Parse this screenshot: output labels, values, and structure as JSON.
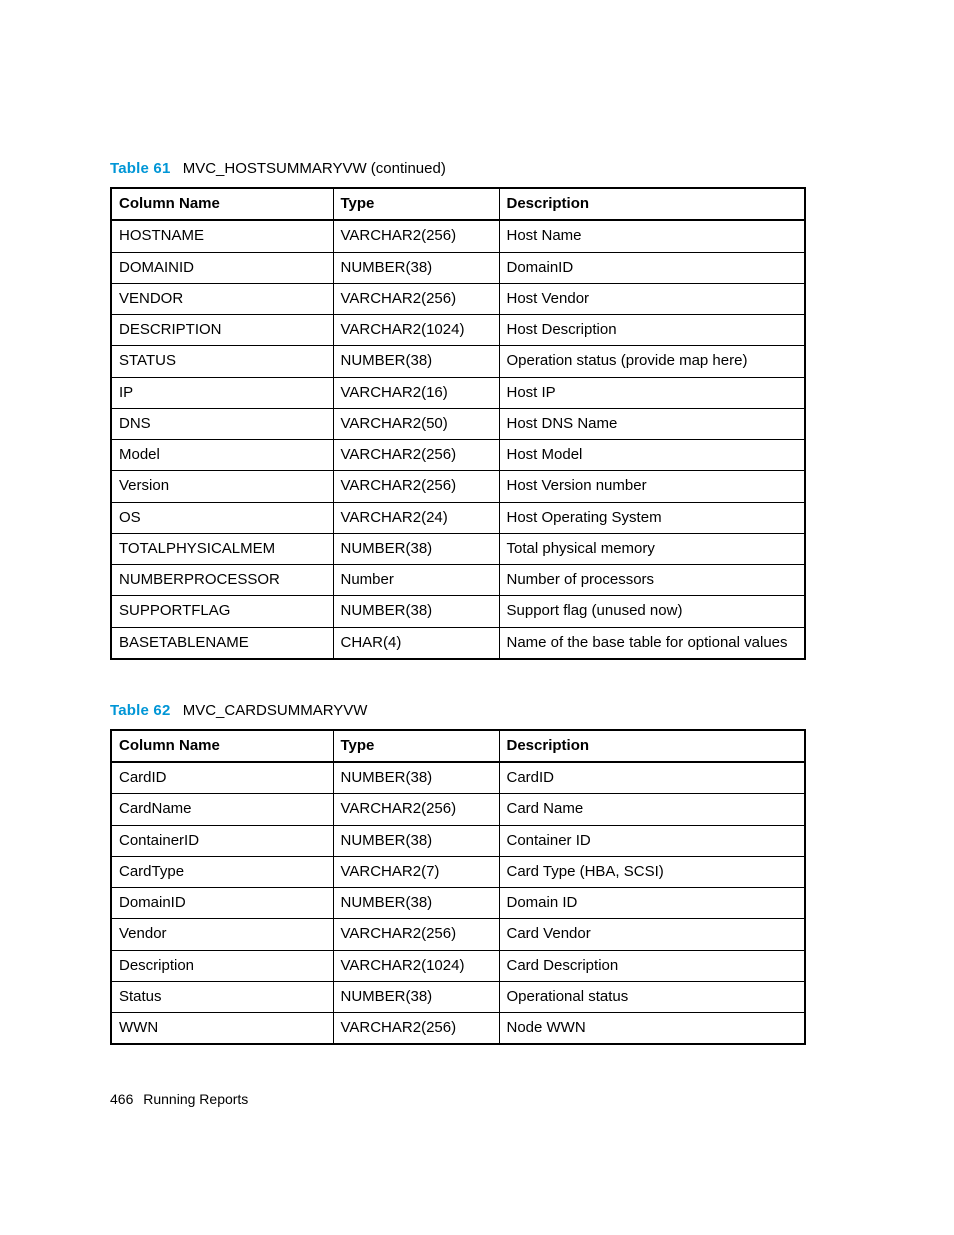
{
  "table61": {
    "label": "Table 61",
    "title": "MVC_HOSTSUMMARYVW (continued)",
    "headers": {
      "col": "Column Name",
      "type": "Type",
      "desc": "Description"
    },
    "rows": [
      {
        "col": "HOSTNAME",
        "type": "VARCHAR2(256)",
        "desc": "Host Name"
      },
      {
        "col": "DOMAINID",
        "type": "NUMBER(38)",
        "desc": "DomainID"
      },
      {
        "col": "VENDOR",
        "type": "VARCHAR2(256)",
        "desc": "Host Vendor"
      },
      {
        "col": "DESCRIPTION",
        "type": "VARCHAR2(1024)",
        "desc": "Host Description"
      },
      {
        "col": "STATUS",
        "type": "NUMBER(38)",
        "desc": "Operation status (provide map here)"
      },
      {
        "col": "IP",
        "type": "VARCHAR2(16)",
        "desc": "Host IP"
      },
      {
        "col": "DNS",
        "type": "VARCHAR2(50)",
        "desc": "Host DNS Name"
      },
      {
        "col": "Model",
        "type": "VARCHAR2(256)",
        "desc": "Host Model"
      },
      {
        "col": "Version",
        "type": "VARCHAR2(256)",
        "desc": "Host Version number"
      },
      {
        "col": "OS",
        "type": "VARCHAR2(24)",
        "desc": "Host Operating System"
      },
      {
        "col": "TOTALPHYSICALMEM",
        "type": "NUMBER(38)",
        "desc": "Total physical memory"
      },
      {
        "col": "NUMBERPROCESSOR",
        "type": "Number",
        "desc": "Number of processors"
      },
      {
        "col": "SUPPORTFLAG",
        "type": "NUMBER(38)",
        "desc": "Support flag (unused now)"
      },
      {
        "col": "BASETABLENAME",
        "type": "CHAR(4)",
        "desc": "Name of the base table for optional values"
      }
    ]
  },
  "table62": {
    "label": "Table 62",
    "title": "MVC_CARDSUMMARYVW",
    "headers": {
      "col": "Column Name",
      "type": "Type",
      "desc": "Description"
    },
    "rows": [
      {
        "col": "CardID",
        "type": "NUMBER(38)",
        "desc": "CardID"
      },
      {
        "col": "CardName",
        "type": "VARCHAR2(256)",
        "desc": "Card Name"
      },
      {
        "col": "ContainerID",
        "type": "NUMBER(38)",
        "desc": "Container ID"
      },
      {
        "col": "CardType",
        "type": "VARCHAR2(7)",
        "desc": "Card Type (HBA, SCSI)"
      },
      {
        "col": "DomainID",
        "type": "NUMBER(38)",
        "desc": "Domain ID"
      },
      {
        "col": "Vendor",
        "type": "VARCHAR2(256)",
        "desc": "Card Vendor"
      },
      {
        "col": "Description",
        "type": "VARCHAR2(1024)",
        "desc": "Card Description"
      },
      {
        "col": "Status",
        "type": "NUMBER(38)",
        "desc": "Operational status"
      },
      {
        "col": "WWN",
        "type": "VARCHAR2(256)",
        "desc": "Node WWN"
      }
    ]
  },
  "footer": {
    "page_number": "466",
    "section": "Running Reports"
  }
}
